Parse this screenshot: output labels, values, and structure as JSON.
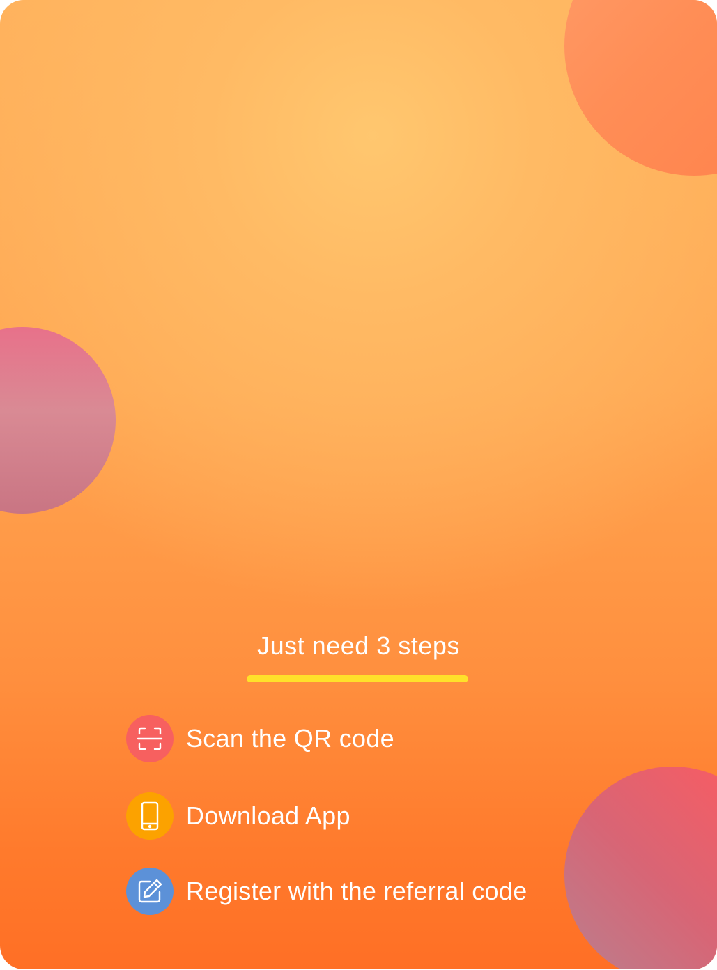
{
  "steps_card": {
    "heading": "Just need 3 steps",
    "accent_color": "#ffe12a",
    "steps": [
      {
        "label": "Scan the QR code",
        "icon": "qr-scan-icon",
        "icon_color": "#f7605f"
      },
      {
        "label": "Download App",
        "icon": "phone-icon",
        "icon_color": "#fca200"
      },
      {
        "label": "Register with the referral code",
        "icon": "edit-icon",
        "icon_color": "#5c91d8"
      }
    ]
  }
}
